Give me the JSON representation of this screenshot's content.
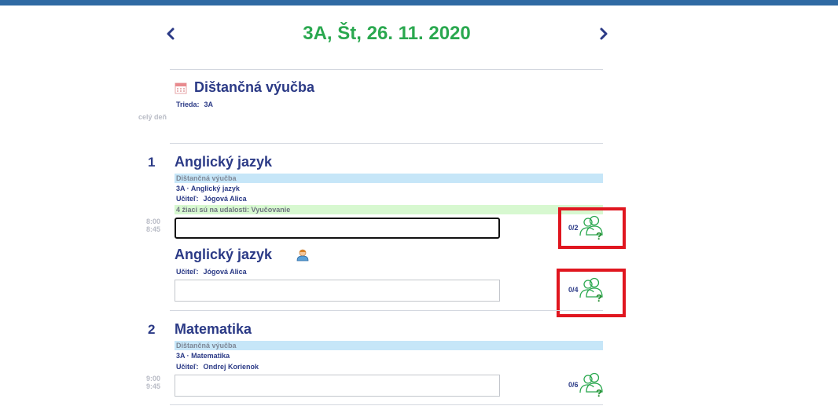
{
  "header": {
    "title": "3A, Št, 26. 11. 2020",
    "prev_icon": "chevron-left-icon",
    "next_icon": "chevron-right-icon"
  },
  "colors": {
    "accent": "#2aa84f",
    "text": "#2b3a86",
    "muted": "#b9bcc6",
    "band_blue": "#c6e6f8",
    "band_green": "#d7f8d0",
    "highlight_red": "#e0161f",
    "topbar": "#2f6aa3"
  },
  "allday": {
    "label": "celý deň",
    "title": "Dištančná výučba",
    "icon": "calendar-icon",
    "class_label": "Trieda:",
    "class_value": "3A"
  },
  "lessons": [
    {
      "number": "1",
      "time_start": "8:00",
      "time_end": "8:45",
      "title": "Anglický jazyk",
      "band_blue": "Dištančná výučba",
      "subject_line": "3A · Anglický jazyk",
      "teacher_label": "Učiteľ:",
      "teacher": "Jógová Alica",
      "band_green": "4 žiaci sú na udalosti: Vyučovanie",
      "attendance": "0/2",
      "attendance_icon": "students-question-icon",
      "group": {
        "title": "Anglický jazyk",
        "icon": "teacher-icon",
        "teacher_label": "Učiteľ:",
        "teacher": "Jógová Alica",
        "attendance": "0/4"
      }
    },
    {
      "number": "2",
      "time_start": "9:00",
      "time_end": "9:45",
      "title": "Matematika",
      "band_blue": "Dištančná výučba",
      "subject_line": "3A · Matematika",
      "teacher_label": "Učiteľ:",
      "teacher": "Ondrej Korienok",
      "attendance": "0/6"
    }
  ]
}
